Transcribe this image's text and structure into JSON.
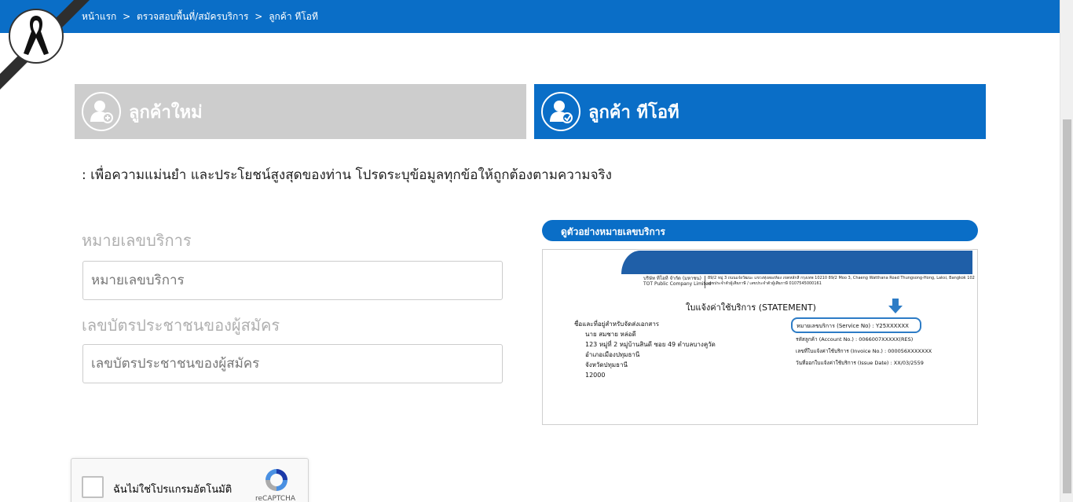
{
  "breadcrumb": {
    "home": "หน้าแรก",
    "separator": ">",
    "check": "ตรวจสอบพื้นที่/สมัครบริการ",
    "current": "ลูกค้า ทีโอที"
  },
  "tabs": [
    {
      "label": "ลูกค้าใหม่",
      "icon": "user-add-icon",
      "active": false
    },
    {
      "label": "ลูกค้า ทีโอที",
      "icon": "user-check-icon",
      "active": true
    }
  ],
  "notice": ": เพื่อความแม่นยำ และประโยชน์สูงสุดของท่าน โปรดระบุข้อมูลทุกข้อให้ถูกต้องตามความจริง",
  "form": {
    "service_no_label": "หมายเลขบริการ",
    "service_no_placeholder": "หมายเลขบริการ",
    "id_card_label": "เลขบัตรประชาชนของผู้สมัคร",
    "id_card_placeholder": "เลขบัตรประชาชนของผู้สมัคร"
  },
  "example": {
    "button_label": "ดูตัวอย่างหมายเลขบริการ",
    "company_th": "บริษัท ทีโอที จำกัด (มหาชน)",
    "company_en": "TOT Public Company Limited",
    "address_line1": "89/2 หมู่ 3 ถนนแจ้งวัฒนะ แขวงทุ่งสองห้อง เขตหลักสี่ กรุงเทพ 10210  89/2 Moo 3, Chaeng Watthana Road Thungsong-Hong, Laksi, Bangkok 10210",
    "address_line2": "เลขประจำตัวผู้เสียภาษี / เลขประจำตัวผู้เสียภาษี 0107545000161",
    "title": "ใบแจ้งค่าใช้บริการ (STATEMENT)",
    "address_heading": "ชื่อและที่อยู่สำหรับจัดส่งเอกสาร",
    "customer_name": "นาย สมชาย  หล่อดี",
    "customer_addr1": "123  หมู่ที่ 2 หมู่บ้านสินดี  ซอย 49  ตำบลบางคูวัด",
    "customer_addr2": "อำเภอเมืองปทุมธานี",
    "customer_addr3": "จังหวัดปทุมธานี",
    "customer_zip": "12000",
    "service_no_row": "หมายเลขบริการ (Service No) : Y25XXXXXX",
    "account_row": "รหัสลูกค้า (Account No.) : 0066007XXXXX(RES)",
    "invoice_row": "เลขที่ใบแจ้งค่าใช้บริการ (Invoice No.) : 000056XXXXXXX",
    "issue_row": "วันที่ออกใบแจ้งค่าใช้บริการ (Issue Date) : XX/03/2559"
  },
  "captcha": {
    "label": "ฉันไม่ใช่โปรแกรมอัตโนมัติ",
    "brand": "reCAPTCHA"
  },
  "colors": {
    "brand_blue": "#0a6ec7",
    "tab_inactive": "#cdcdcd"
  }
}
